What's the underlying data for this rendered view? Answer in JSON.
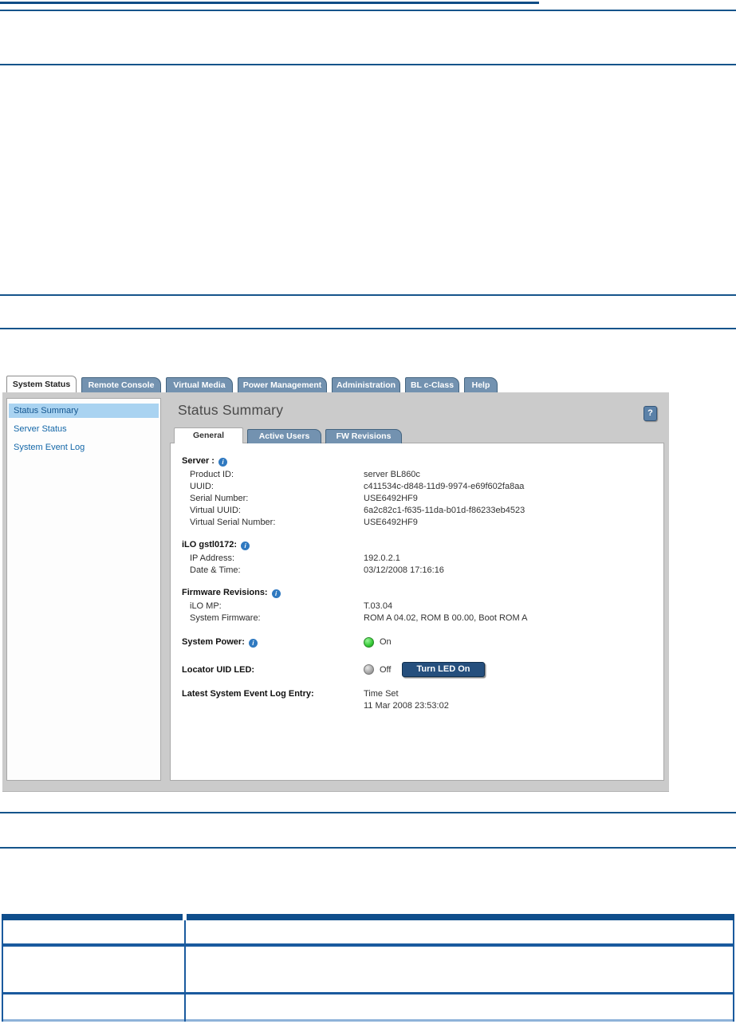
{
  "colors": {
    "rule_blue": "#15548b",
    "tab_slate": "#7392b0",
    "table_header_navy": "#0f4e8c",
    "table_border_blue": "#1a5a9e",
    "table_border_light": "#8fb3d9",
    "sidebar_highlight": "#a9d3f1",
    "button_navy": "#254f7d",
    "led_on_green": "#35c935",
    "led_off_gray": "#a6a6a6"
  },
  "icons": {
    "info": "i",
    "help": "?"
  },
  "screenshot": {
    "nav_tabs": [
      {
        "label": "System Status"
      },
      {
        "label": "Remote Console"
      },
      {
        "label": "Virtual Media"
      },
      {
        "label": "Power Management"
      },
      {
        "label": "Administration"
      },
      {
        "label": "BL c-Class"
      },
      {
        "label": "Help"
      }
    ],
    "sidebar": {
      "items": [
        {
          "label": "Status Summary"
        },
        {
          "label": "Server Status"
        },
        {
          "label": "System Event Log"
        }
      ]
    },
    "main": {
      "title": "Status Summary",
      "sub_tabs": [
        {
          "label": "General"
        },
        {
          "label": "Active Users"
        },
        {
          "label": "FW Revisions"
        }
      ],
      "server": {
        "heading": "Server :",
        "rows": [
          {
            "label": "Product ID:",
            "value": "server BL860c"
          },
          {
            "label": "UUID:",
            "value": "c411534c-d848-11d9-9974-e69f602fa8aa"
          },
          {
            "label": "Serial Number:",
            "value": "USE6492HF9"
          },
          {
            "label": "Virtual UUID:",
            "value": "6a2c82c1-f635-11da-b01d-f86233eb4523"
          },
          {
            "label": "Virtual Serial Number:",
            "value": "USE6492HF9"
          }
        ]
      },
      "ilo": {
        "heading": "iLO gstl0172:",
        "rows": [
          {
            "label": "IP Address:",
            "value": "192.0.2.1"
          },
          {
            "label": "Date & Time:",
            "value": "03/12/2008 17:16:16"
          }
        ]
      },
      "firmware": {
        "heading": "Firmware Revisions:",
        "rows": [
          {
            "label": "iLO MP:",
            "value": "T.03.04"
          },
          {
            "label": "System Firmware:",
            "value": "ROM A 04.02, ROM B 00.00, Boot ROM A"
          }
        ]
      },
      "system_power": {
        "label": "System Power:",
        "status": "On"
      },
      "locator": {
        "label": "Locator UID LED:",
        "status": "Off",
        "button_label": "Turn LED On"
      },
      "latest_log": {
        "label": "Latest System Event Log Entry:",
        "line1": "Time Set",
        "line2": "11 Mar 2008 23:53:02"
      }
    }
  },
  "bottom_table": {
    "header": [
      "",
      ""
    ],
    "rows": [
      [
        "",
        ""
      ],
      [
        "",
        ""
      ],
      [
        "",
        ""
      ]
    ]
  }
}
